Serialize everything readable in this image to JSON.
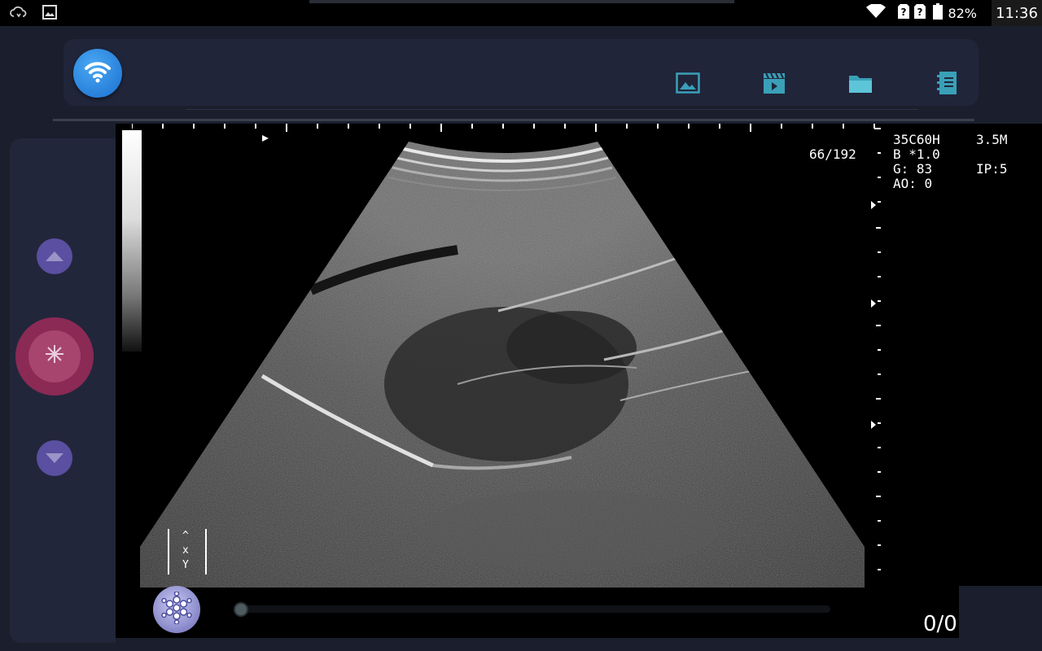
{
  "status_bar": {
    "battery_percent": "82%",
    "time": "11:36",
    "icons": [
      "cloud-sync-icon",
      "image-icon",
      "wifi-signal-icon",
      "no-sim-icon",
      "no-sim-icon",
      "battery-icon"
    ]
  },
  "toolbar": {
    "wifi_button_icon": "wifi-icon",
    "tools": [
      "photo-icon",
      "video-icon",
      "folder-icon",
      "report-icon"
    ],
    "accent_color": "#3aa0b8"
  },
  "left_panel": {
    "up_icon": "triangle-up-icon",
    "freeze_icon": "snowflake-icon",
    "down_icon": "triangle-down-icon"
  },
  "image": {
    "depth_marker": "66/192",
    "info": {
      "probe": "35C60H",
      "frequency": "3.5M",
      "mode": "B *1.0",
      "gain": "G: 83",
      "ip": "IP:5",
      "ao": "AO: 0"
    },
    "body_mark": "^\nx\nY"
  },
  "cine": {
    "frame_counter": "0/0",
    "progress": 0
  }
}
